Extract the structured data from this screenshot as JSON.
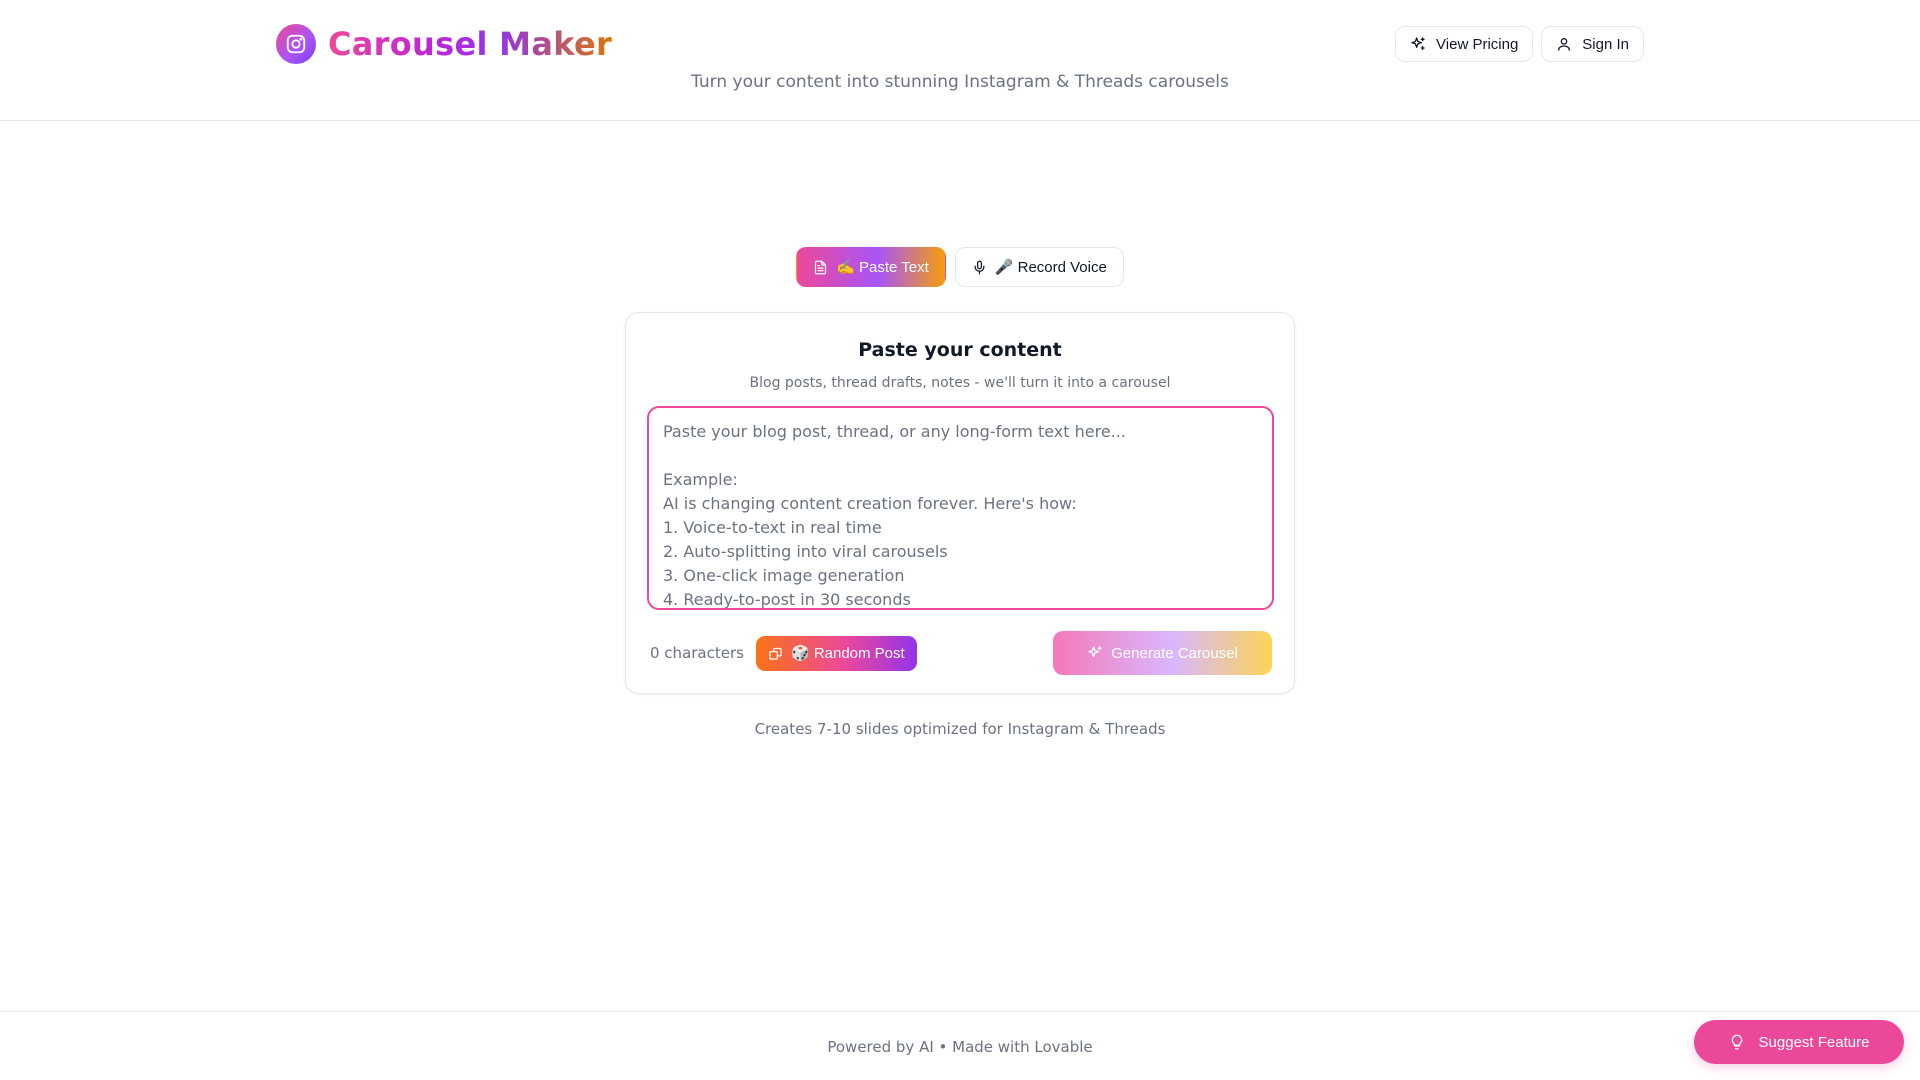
{
  "brand": {
    "title": "Carousel Maker",
    "tagline": "Turn your content into stunning Instagram & Threads carousels",
    "logo_icon": "instagram-icon"
  },
  "header": {
    "pricing_label": "View Pricing",
    "pricing_icon": "sparkles-icon",
    "signin_label": "Sign In",
    "signin_icon": "user-icon"
  },
  "modes": {
    "paste": {
      "label": "✍️ Paste Text",
      "icon": "file-text-icon",
      "active": true
    },
    "voice": {
      "label": "🎤 Record Voice",
      "icon": "microphone-icon",
      "active": false
    }
  },
  "card": {
    "title": "Paste your content",
    "subtitle": "Blog posts, thread drafts, notes - we'll turn it into a carousel",
    "placeholder": "Paste your blog post, thread, or any long-form text here...\n\nExample:\nAI is changing content creation forever. Here's how:\n1. Voice-to-text in real time\n2. Auto-splitting into viral carousels\n3. One-click image generation\n4. Ready-to-post in 30 seconds",
    "value": "",
    "char_count": "0 characters",
    "random_label": "🎲 Random Post",
    "random_icon": "shuffle-icon",
    "generate_label": "Generate Carousel",
    "generate_icon": "sparkles-icon",
    "generate_disabled": true
  },
  "hint": "Creates 7-10 slides optimized for Instagram & Threads",
  "footer": {
    "text": "Powered by AI • Made with Lovable",
    "suggest_label": "Suggest Feature",
    "suggest_icon": "lightbulb-icon"
  },
  "colors": {
    "accent_pink": "#ec4899",
    "accent_purple": "#a855f7",
    "accent_orange": "#f59e0b",
    "muted_text": "#6b7280",
    "border": "#e5e7eb"
  }
}
